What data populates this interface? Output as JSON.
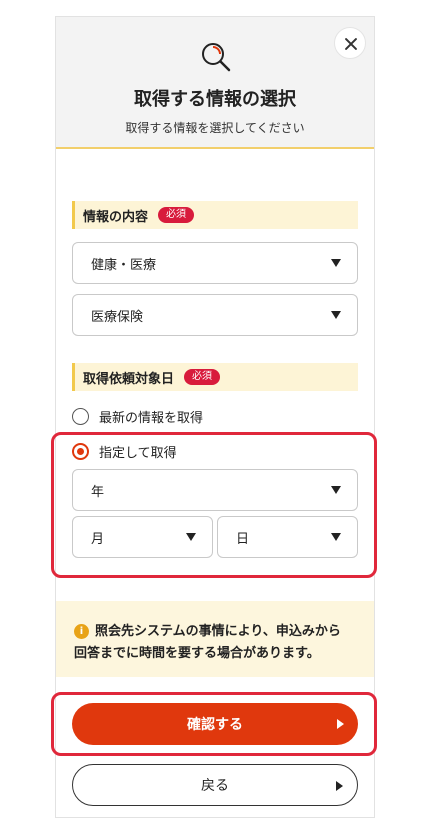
{
  "header": {
    "title": "取得する情報の選択",
    "subtitle": "取得する情報を選択してください",
    "icon": "search-icon",
    "close_icon": "close-icon"
  },
  "info_section": {
    "label": "情報の内容",
    "badge": "必須",
    "select1": "健康・医療",
    "select2": "医療保険"
  },
  "date_section": {
    "label": "取得依頼対象日",
    "badge": "必須",
    "radio_latest": "最新の情報を取得",
    "radio_specified": "指定して取得",
    "selected_option": "指定して取得",
    "year": "年",
    "month": "月",
    "day": "日"
  },
  "notice": {
    "line1": "照会先システムの事情により、申込みから",
    "line2": "回答までに時間を要する場合があります。",
    "icon": "info-icon"
  },
  "buttons": {
    "confirm": "確認する",
    "back": "戻る"
  },
  "colors": {
    "accent": "#e0380d",
    "required_badge": "#d81b3c",
    "highlight": "#e0283b",
    "section_bg": "#fdf4d6",
    "notice_bg": "#fdf6dd"
  }
}
